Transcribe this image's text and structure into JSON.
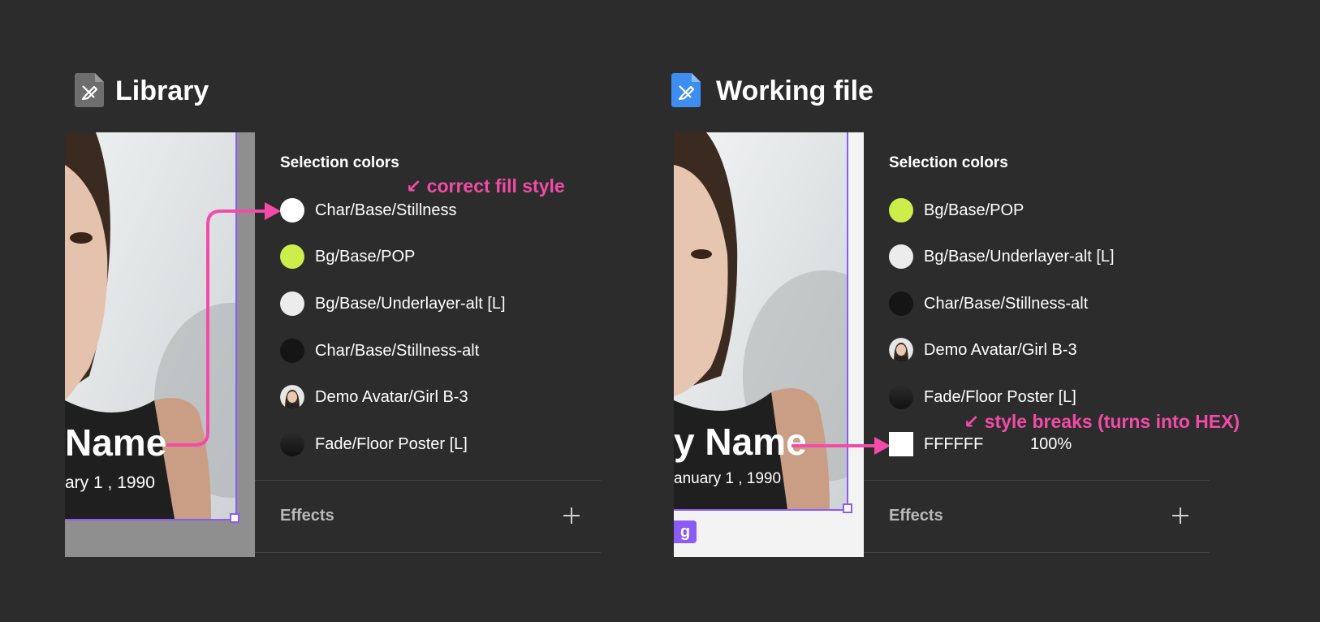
{
  "library": {
    "title": "Library",
    "photo_overlay": {
      "name": "Name",
      "date": "ary 1 , 1990"
    },
    "panel": {
      "heading": "Selection colors",
      "annotation": "correct fill style",
      "colors": [
        {
          "label": "Char/Base/Stillness",
          "swatch": "#ffffff",
          "kind": "circle"
        },
        {
          "label": "Bg/Base/POP",
          "swatch": "#cdee4a",
          "kind": "circle"
        },
        {
          "label": "Bg/Base/Underlayer-alt [L]",
          "swatch": "#ececec",
          "kind": "circle"
        },
        {
          "label": "Char/Base/Stillness-alt",
          "swatch": "#151515",
          "kind": "circle"
        },
        {
          "label": "Demo Avatar/Girl B-3",
          "swatch": "avatar",
          "kind": "avatar"
        },
        {
          "label": "Fade/Floor Poster [L]",
          "swatch": "fade",
          "kind": "fade"
        }
      ],
      "effects_label": "Effects"
    }
  },
  "working": {
    "title": "Working file",
    "photo_overlay": {
      "name": "y Name",
      "date": "anuary 1 , 1990",
      "tag": "g"
    },
    "panel": {
      "heading": "Selection colors",
      "annotation": "style breaks (turns into HEX)",
      "colors": [
        {
          "label": "Bg/Base/POP",
          "swatch": "#cdee4a",
          "kind": "circle"
        },
        {
          "label": "Bg/Base/Underlayer-alt [L]",
          "swatch": "#ececec",
          "kind": "circle"
        },
        {
          "label": "Char/Base/Stillness-alt",
          "swatch": "#151515",
          "kind": "circle"
        },
        {
          "label": "Demo Avatar/Girl B-3",
          "swatch": "avatar",
          "kind": "avatar"
        },
        {
          "label": "Fade/Floor Poster [L]",
          "swatch": "fade",
          "kind": "fade"
        },
        {
          "label": "FFFFFF",
          "swatch": "#ffffff",
          "kind": "square",
          "opacity": "100%"
        }
      ],
      "effects_label": "Effects"
    }
  },
  "colors": {
    "background": "#2c2c2c",
    "annotation": "#f24ba8",
    "selection": "#8a5cf5",
    "library_icon": "#6e6e6e",
    "working_icon": "#3d8ef0"
  },
  "icons": {
    "library_file": "figma-library-file-icon",
    "working_file": "figma-design-file-icon",
    "add": "plus-icon",
    "annotation_arrow": "arrow-down-left-icon"
  }
}
